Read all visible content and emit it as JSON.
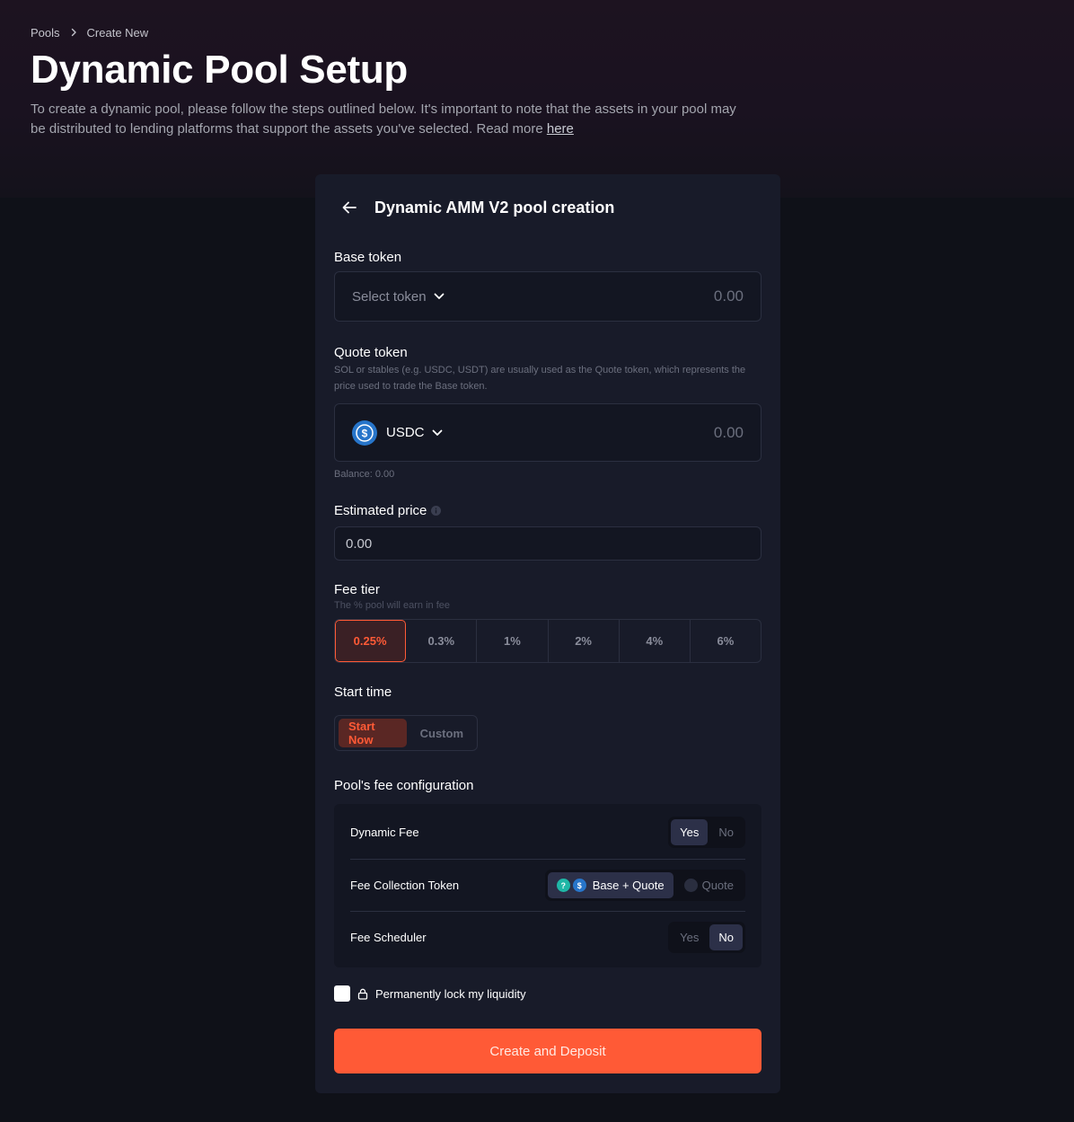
{
  "breadcrumb": {
    "root": "Pools",
    "current": "Create New"
  },
  "page": {
    "title": "Dynamic Pool Setup",
    "description": "To create a dynamic pool, please follow the steps outlined below. It's important to note that the assets in your pool may be distributed to lending platforms that support the assets you've selected. Read more ",
    "link_text": "here"
  },
  "card": {
    "title": "Dynamic AMM V2 pool creation",
    "base_token": {
      "label": "Base token",
      "select_text": "Select token",
      "amount": "0.00"
    },
    "quote_token": {
      "label": "Quote token",
      "help": "SOL or stables (e.g. USDC, USDT) are usually used as the Quote token, which represents the price used to trade the Base token.",
      "symbol": "USDC",
      "amount": "0.00",
      "balance": "Balance: 0.00"
    },
    "estimated_price": {
      "label": "Estimated price",
      "value": "0.00"
    },
    "fee_tier": {
      "label": "Fee tier",
      "help": "The % pool will earn in fee",
      "options": [
        "0.25%",
        "0.3%",
        "1%",
        "2%",
        "4%",
        "6%"
      ],
      "selected": "0.25%"
    },
    "start_time": {
      "label": "Start time",
      "options": [
        "Start Now",
        "Custom"
      ],
      "selected": "Start Now"
    },
    "fee_config": {
      "label": "Pool's fee configuration",
      "dynamic_fee": {
        "label": "Dynamic Fee",
        "options": [
          "Yes",
          "No"
        ],
        "selected": "Yes"
      },
      "collection_token": {
        "label": "Fee Collection Token",
        "options": [
          "Base + Quote",
          "Quote"
        ],
        "selected": "Base + Quote"
      },
      "scheduler": {
        "label": "Fee Scheduler",
        "options": [
          "Yes",
          "No"
        ],
        "selected": "No"
      }
    },
    "lock_liquidity": {
      "label": "Permanently lock my liquidity",
      "checked": false
    },
    "submit_label": "Create and Deposit"
  },
  "colors": {
    "accent": "#ff5a36",
    "card_bg": "#181b29",
    "page_bg": "#0f1118",
    "usdc": "#2775ca"
  }
}
